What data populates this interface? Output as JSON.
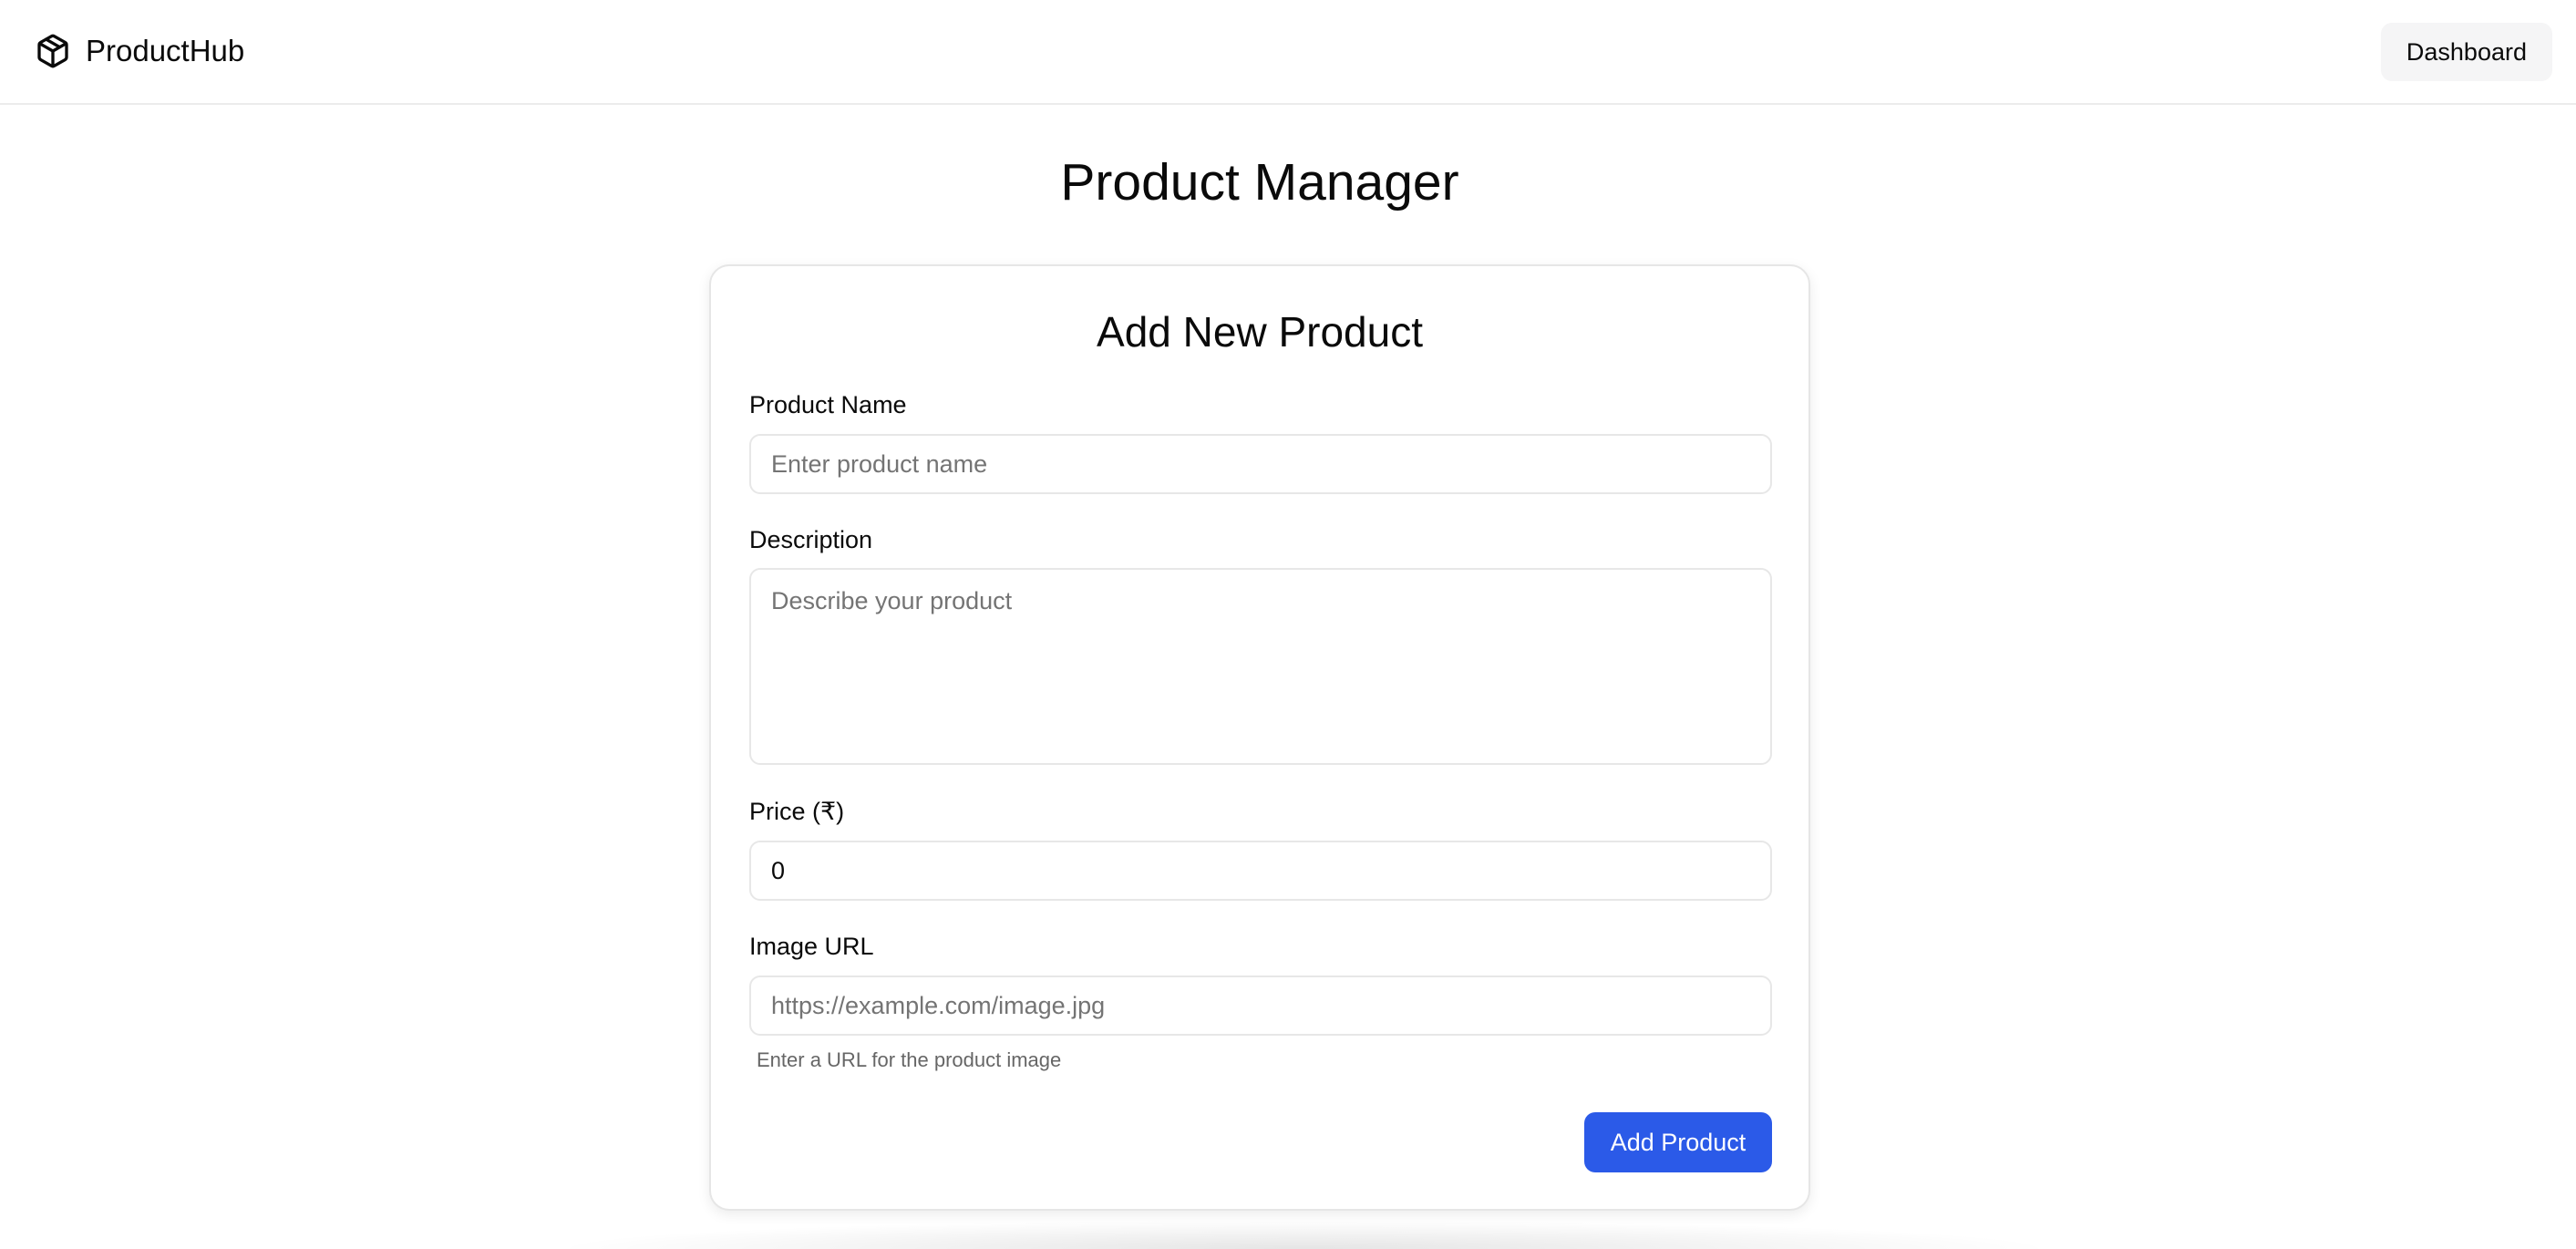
{
  "header": {
    "brand_name": "ProductHub",
    "brand_icon": "package-icon",
    "dashboard_label": "Dashboard"
  },
  "page": {
    "title": "Product Manager"
  },
  "form": {
    "title": "Add New Product",
    "name": {
      "label": "Product Name",
      "placeholder": "Enter product name",
      "value": ""
    },
    "description": {
      "label": "Description",
      "placeholder": "Describe your product",
      "value": ""
    },
    "price": {
      "label": "Price (₹)",
      "value": "0"
    },
    "image_url": {
      "label": "Image URL",
      "placeholder": "https://example.com/image.jpg",
      "value": "",
      "hint": "Enter a URL for the product image"
    },
    "submit_label": "Add Product"
  },
  "colors": {
    "accent": "#2b5ae8",
    "border": "#e7e7e7",
    "muted_text": "#747474"
  }
}
